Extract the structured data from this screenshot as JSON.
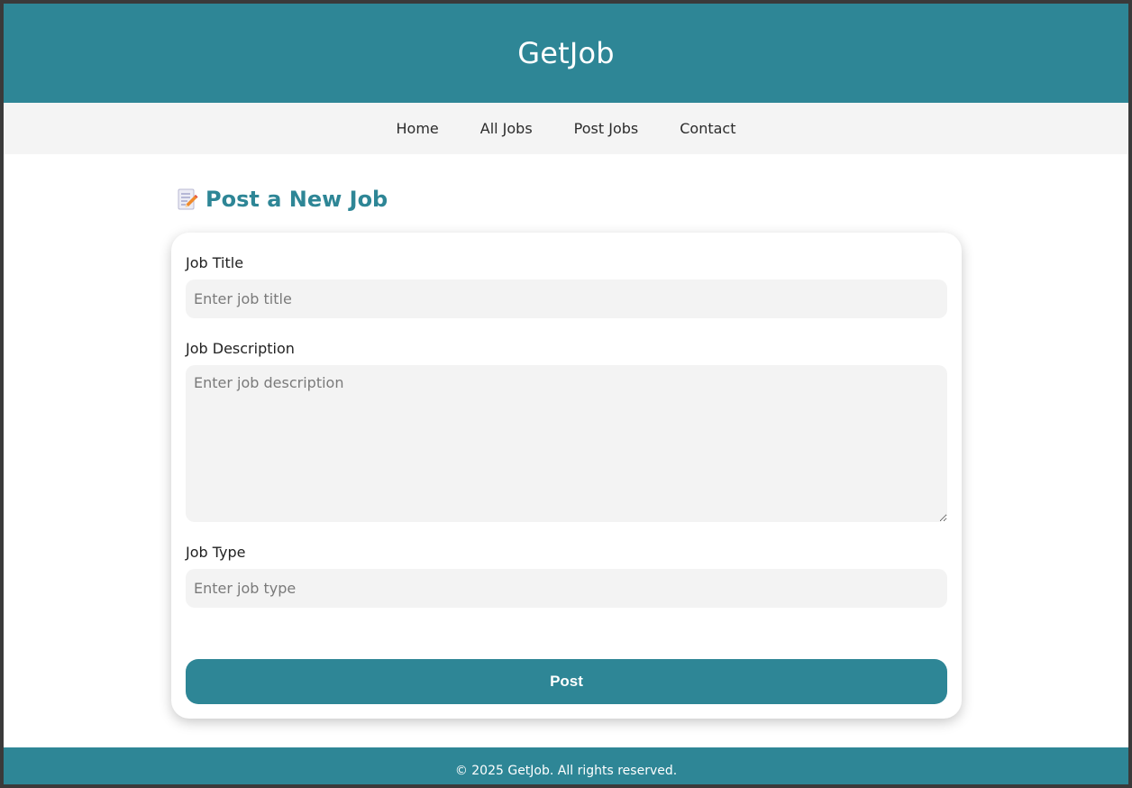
{
  "header": {
    "site_title": "GetJob"
  },
  "nav": {
    "items": [
      {
        "label": "Home"
      },
      {
        "label": "All Jobs"
      },
      {
        "label": "Post Jobs"
      },
      {
        "label": "Contact"
      }
    ]
  },
  "page": {
    "heading": "Post a New Job",
    "heading_icon": "memo-icon"
  },
  "form": {
    "job_title": {
      "label": "Job Title",
      "placeholder": "Enter job title",
      "value": ""
    },
    "job_description": {
      "label": "Job Description",
      "placeholder": "Enter job description",
      "value": ""
    },
    "job_type": {
      "label": "Job Type",
      "placeholder": "Enter job type",
      "value": ""
    },
    "submit_label": "Post"
  },
  "footer": {
    "text": "© 2025 GetJob. All rights reserved."
  },
  "colors": {
    "brand": "#2e8696",
    "nav_background": "#f4f4f4",
    "field_background": "#f3f3f3"
  }
}
